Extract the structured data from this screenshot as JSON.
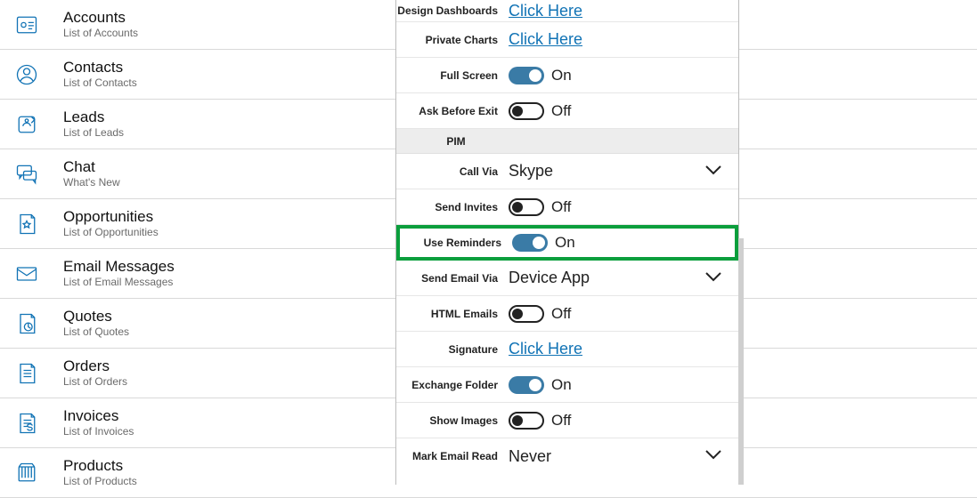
{
  "nav": [
    {
      "title": "Accounts",
      "sub": "List of Accounts"
    },
    {
      "title": "Contacts",
      "sub": "List of Contacts"
    },
    {
      "title": "Leads",
      "sub": "List of Leads"
    },
    {
      "title": "Chat",
      "sub": "What's New"
    },
    {
      "title": "Opportunities",
      "sub": "List of Opportunities"
    },
    {
      "title": "Email Messages",
      "sub": "List of Email Messages"
    },
    {
      "title": "Quotes",
      "sub": "List of Quotes"
    },
    {
      "title": "Orders",
      "sub": "List of Orders"
    },
    {
      "title": "Invoices",
      "sub": "List of Invoices"
    },
    {
      "title": "Products",
      "sub": "List of Products"
    }
  ],
  "settings": {
    "design_dashboards": {
      "label": "Design Dashboards",
      "link": "Click Here"
    },
    "private_charts": {
      "label": "Private Charts",
      "link": "Click Here"
    },
    "full_screen": {
      "label": "Full Screen",
      "state": "On"
    },
    "ask_before_exit": {
      "label": "Ask Before Exit",
      "state": "Off"
    },
    "section_pim": "PIM",
    "call_via": {
      "label": "Call Via",
      "value": "Skype"
    },
    "send_invites": {
      "label": "Send Invites",
      "state": "Off"
    },
    "use_reminders": {
      "label": "Use Reminders",
      "state": "On"
    },
    "send_email_via": {
      "label": "Send Email Via",
      "value": "Device App"
    },
    "html_emails": {
      "label": "HTML Emails",
      "state": "Off"
    },
    "signature": {
      "label": "Signature",
      "link": "Click Here"
    },
    "exchange_folder": {
      "label": "Exchange Folder",
      "state": "On"
    },
    "show_images": {
      "label": "Show Images",
      "state": "Off"
    },
    "mark_email_read": {
      "label": "Mark Email Read",
      "value": "Never"
    }
  },
  "highlight": "use_reminders"
}
